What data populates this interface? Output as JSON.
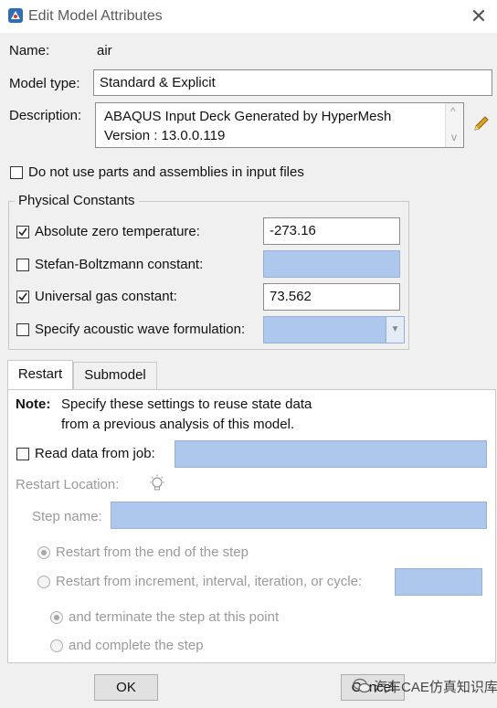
{
  "window": {
    "title": "Edit Model Attributes",
    "close_glyph": "✕"
  },
  "name": {
    "label": "Name:",
    "value": "air"
  },
  "model_type": {
    "label": "Model type:",
    "value": "Standard & Explicit"
  },
  "description": {
    "label": "Description:",
    "line1": "ABAQUS Input Deck Generated by HyperMesh",
    "line2": "Version  : 13.0.0.119",
    "scroll_up": "^",
    "scroll_down": "v"
  },
  "no_parts": {
    "label": "Do not use parts and assemblies in input files",
    "checked": false
  },
  "physical_constants": {
    "legend": "Physical Constants",
    "absolute_zero": {
      "label": "Absolute zero temperature:",
      "checked": true,
      "value": "-273.16"
    },
    "stefan_boltzmann": {
      "label": "Stefan-Boltzmann constant:",
      "checked": false,
      "value": ""
    },
    "universal_gas": {
      "label": "Universal gas constant:",
      "checked": true,
      "value": "73.562"
    },
    "acoustic_wave": {
      "label": "Specify acoustic wave formulation:",
      "checked": false,
      "value": ""
    }
  },
  "tabs": [
    {
      "label": "Restart",
      "active": true
    },
    {
      "label": "Submodel",
      "active": false
    }
  ],
  "restart": {
    "note_label": "Note:",
    "note_line1": "Specify these settings to reuse state data",
    "note_line2": "from a previous analysis of this model.",
    "read_data": {
      "label": "Read data from job:",
      "checked": false,
      "value": ""
    },
    "restart_location_label": "Restart Location:",
    "step_name_label": "Step name:",
    "radio_end_of_step": "Restart from the end of the step",
    "radio_increment": "Restart from increment, interval, iteration, or cycle:",
    "radio_terminate": "and terminate the step at this point",
    "radio_complete": "and complete the step"
  },
  "buttons": {
    "ok": "OK",
    "cancel": "Cancel"
  },
  "watermark": "汽车CAE仿真知识库",
  "colors": {
    "accent_field": "#adc8ec",
    "pencil": "#e0a020"
  },
  "icons": {
    "app": "abaqus-app-icon",
    "pencil": "pencil-icon",
    "bulb": "lightbulb-icon",
    "close": "close-icon"
  }
}
